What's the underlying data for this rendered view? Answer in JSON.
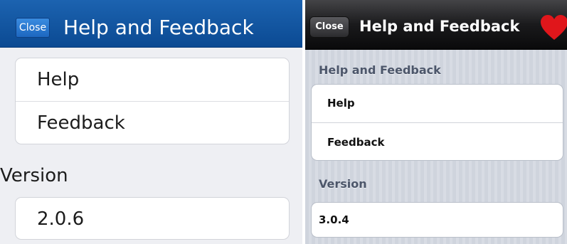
{
  "left_screen": {
    "navbar": {
      "close_label": "Close",
      "title": "Help and Feedback"
    },
    "menu": {
      "items": [
        {
          "label": "Help"
        },
        {
          "label": "Feedback"
        }
      ]
    },
    "version": {
      "section_label": "Version",
      "value": "2.0.6"
    }
  },
  "right_screen": {
    "navbar": {
      "close_label": "Close",
      "title": "Help and Feedback",
      "icon": "heart-icon",
      "icon_color": "#e0161b"
    },
    "menu": {
      "section_label": "Help and Feedback",
      "items": [
        {
          "label": "Help"
        },
        {
          "label": "Feedback"
        }
      ]
    },
    "version": {
      "section_label": "Version",
      "value": "3.0.4"
    }
  },
  "colors": {
    "left_navbar": "#0b4a93",
    "left_background": "#eeeff3",
    "right_navbar": "#1a1a1c",
    "right_background": "#d3d8e0"
  }
}
